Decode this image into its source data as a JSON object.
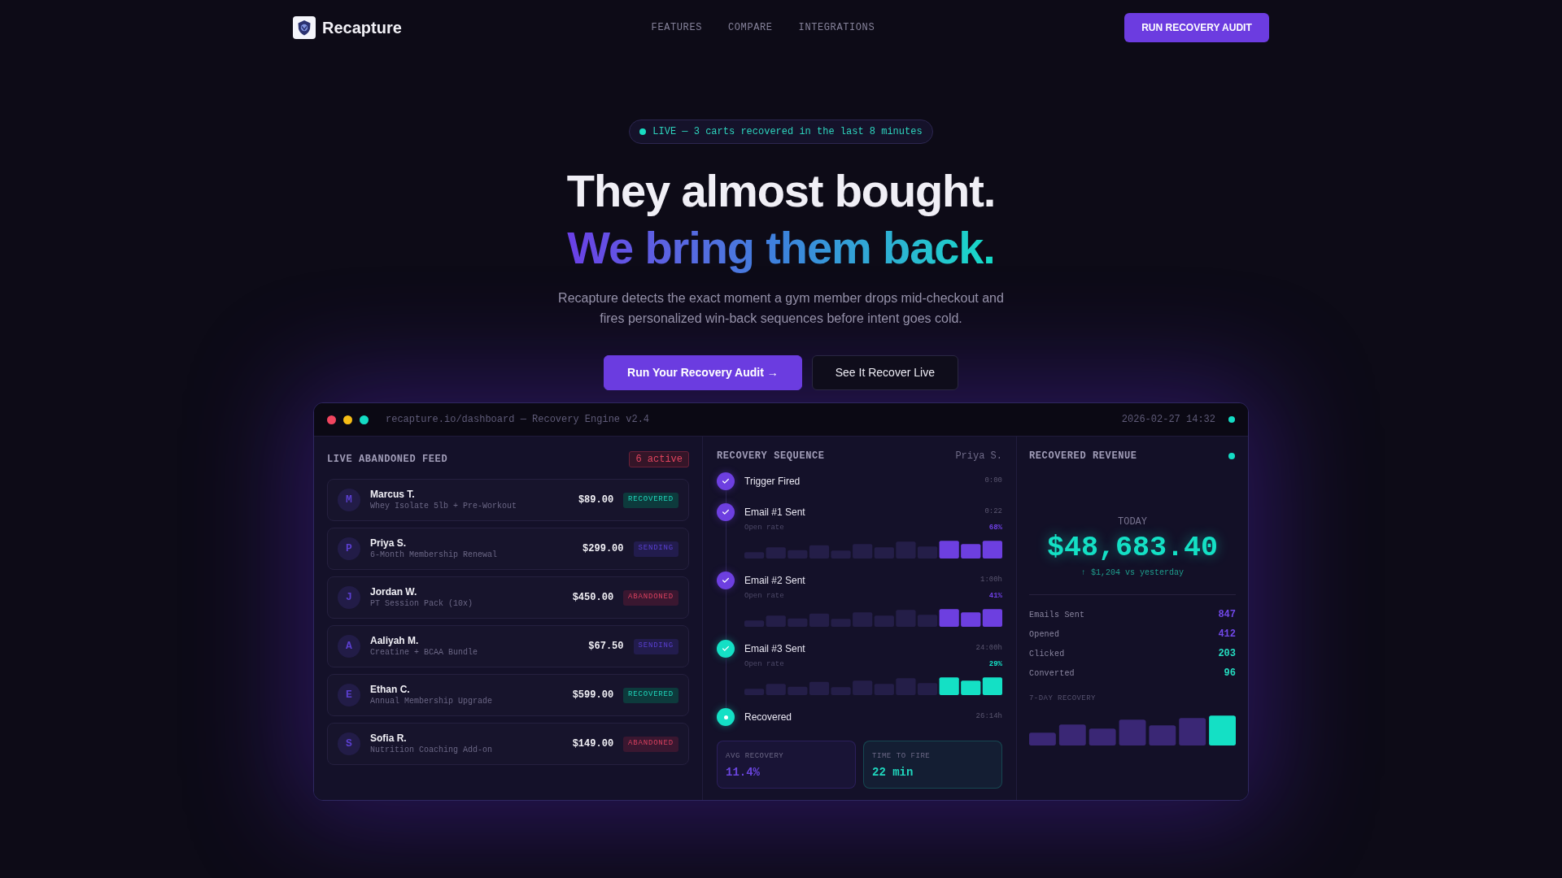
{
  "nav": {
    "brand": "Recapture",
    "links": [
      "FEATURES",
      "COMPARE",
      "INTEGRATIONS"
    ],
    "cta": "RUN RECOVERY AUDIT"
  },
  "hero": {
    "live_badge": "LIVE — 3 carts recovered in the last 8 minutes",
    "headline": "They almost bought.",
    "headline_accent": "We bring them back.",
    "subtitle": "Recapture detects the exact moment a gym member drops mid-checkout and fires personalized win-back sequences before intent goes cold.",
    "buttons": [
      {
        "label": "Run Your Recovery Audit →",
        "kind": "primary"
      },
      {
        "label": "See It Recover Live",
        "kind": "secondary"
      }
    ]
  },
  "dashboard": {
    "url": "recapture.io/dashboard — Recovery Engine v2.4",
    "timestamp": "2026-02-27 14:32",
    "feed": {
      "title": "LIVE ABANDONED FEED",
      "count": "6 active",
      "rows": [
        {
          "initial": "M",
          "name": "Marcus T.",
          "item": "Whey Isolate 5lb + Pre-Workout",
          "price": "$89.00",
          "status": "RECOVERED",
          "kind": "recovered"
        },
        {
          "initial": "P",
          "name": "Priya S.",
          "item": "6-Month Membership Renewal",
          "price": "$299.00",
          "status": "SENDING",
          "kind": "sending"
        },
        {
          "initial": "J",
          "name": "Jordan W.",
          "item": "PT Session Pack (10x)",
          "price": "$450.00",
          "status": "ABANDONED",
          "kind": "abandoned"
        },
        {
          "initial": "A",
          "name": "Aaliyah M.",
          "item": "Creatine + BCAA Bundle",
          "price": "$67.50",
          "status": "SENDING",
          "kind": "sending"
        },
        {
          "initial": "E",
          "name": "Ethan C.",
          "item": "Annual Membership Upgrade",
          "price": "$599.00",
          "status": "RECOVERED",
          "kind": "recovered"
        },
        {
          "initial": "S",
          "name": "Sofia R.",
          "item": "Nutrition Coaching Add-on",
          "price": "$149.00",
          "status": "ABANDONED",
          "kind": "abandoned"
        }
      ]
    },
    "sequence": {
      "title": "RECOVERY SEQUENCE",
      "customer": "Priya S.",
      "steps": [
        {
          "kind": "trigger",
          "label": "Trigger Fired",
          "time": "0:00",
          "color": "#6d3fe0"
        },
        {
          "kind": "email",
          "label": "Email #1 Sent",
          "time": "0:22",
          "color": "#6d3fe0",
          "metric": {
            "label": "Open rate",
            "value": "68%"
          }
        },
        {
          "kind": "email",
          "label": "Email #2 Sent",
          "time": "1:00h",
          "color": "#6d3fe0",
          "metric": {
            "label": "Open rate",
            "value": "41%"
          }
        },
        {
          "kind": "email",
          "label": "Email #3 Sent",
          "time": "24:00h",
          "color": "#14e0c5",
          "metric": {
            "label": "Open rate",
            "value": "29%"
          }
        },
        {
          "kind": "recovered",
          "label": "Recovered",
          "time": "26:14h",
          "color": "#14e0c5"
        }
      ],
      "stats": [
        {
          "label": "AVG RECOVERY",
          "value": "11.4%",
          "color": "#6a45de"
        },
        {
          "label": "TIME TO FIRE",
          "value": "22 min",
          "color": "#1fd6bd"
        }
      ]
    },
    "revenue": {
      "title": "RECOVERED REVENUE",
      "period": "TODAY",
      "amount": "$48,683.40",
      "change": "↑ $1,204 vs yesterday",
      "metrics": [
        {
          "label": "Emails Sent",
          "value": "847",
          "color": "#7048e8"
        },
        {
          "label": "Opened",
          "value": "412",
          "color": "#7048e8"
        },
        {
          "label": "Clicked",
          "value": "203",
          "color": "#25dcc0"
        },
        {
          "label": "Converted",
          "value": "96",
          "color": "#25dcc0"
        }
      ],
      "trend_title": "7-DAY RECOVERY"
    }
  }
}
